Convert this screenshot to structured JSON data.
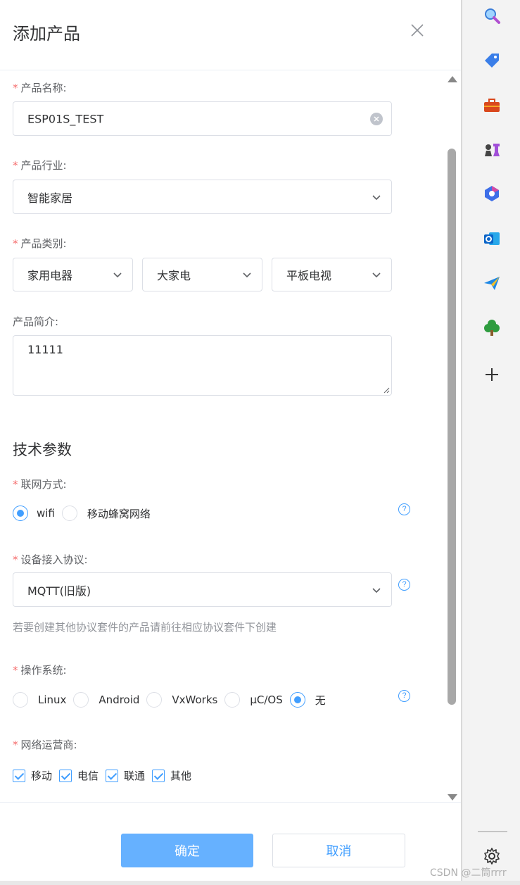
{
  "dialog": {
    "title": "添加产品",
    "close_icon": "close-icon"
  },
  "form": {
    "product_name": {
      "label": "产品名称:",
      "value": "ESP01S_TEST"
    },
    "industry": {
      "label": "产品行业:",
      "value": "智能家居"
    },
    "category": {
      "label": "产品类别:",
      "values": [
        "家用电器",
        "大家电",
        "平板电视"
      ]
    },
    "description": {
      "label": "产品简介:",
      "value": "11111"
    },
    "tech_section_title": "技术参数",
    "network": {
      "label": "联网方式:",
      "options": [
        "wifi",
        "移动蜂窝网络"
      ],
      "selected": "wifi"
    },
    "protocol": {
      "label": "设备接入协议:",
      "value": "MQTT(旧版)",
      "hint": "若要创建其他协议套件的产品请前往相应协议套件下创建"
    },
    "os": {
      "label": "操作系统:",
      "options": [
        "Linux",
        "Android",
        "VxWorks",
        "μC/OS",
        "无"
      ],
      "selected": "无"
    },
    "carrier": {
      "label": "网络运营商:",
      "options": [
        "移动",
        "电信",
        "联通",
        "其他"
      ],
      "checked": [
        "移动",
        "电信",
        "联通",
        "其他"
      ]
    },
    "required_mark": "*",
    "help_mark": "?"
  },
  "footer": {
    "confirm_label": "确定",
    "cancel_label": "取消"
  },
  "sidebar": {
    "icons": [
      "search-icon",
      "tag-icon",
      "toolbox-icon",
      "chess-icon",
      "copilot-icon",
      "outlook-icon",
      "send-icon",
      "tree-icon",
      "add-icon",
      "settings-icon"
    ]
  },
  "watermark": "CSDN @二筒rrrr",
  "colors": {
    "primary": "#409eff",
    "primary_light": "#66b1ff",
    "required": "#f56c6c",
    "border": "#dcdfe6"
  }
}
